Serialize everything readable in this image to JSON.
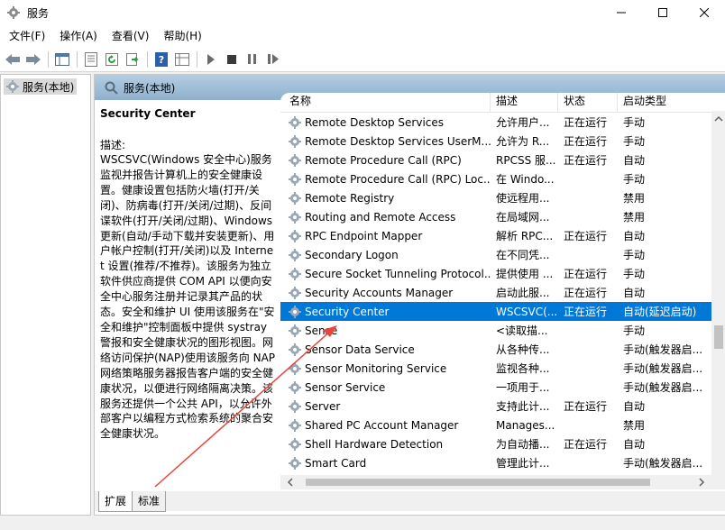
{
  "window": {
    "title": "服务"
  },
  "menu": [
    "文件(F)",
    "操作(A)",
    "查看(V)",
    "帮助(H)"
  ],
  "tree": {
    "root": "服务(本地)"
  },
  "panel": {
    "header": "服务(本地)"
  },
  "description": {
    "title": "Security Center",
    "label": "描述:",
    "body": "WSCSVC(Windows 安全中心)服务监视并报告计算机上的安全健康设置。健康设置包括防火墙(打开/关闭)、防病毒(打开/关闭/过期)、反间谍软件(打开/关闭/过期)、Windows 更新(自动/手动下载并安装更新)、用户帐户控制(打开/关闭)以及 Internet 设置(推荐/不推荐)。该服务为独立软件供应商提供 COM API 以便向安全中心服务注册并记录其产品的状态。安全和维护 UI 使用该服务在\"安全和维护\"控制面板中提供 systray 警报和安全健康状况的图形视图。网络访问保护(NAP)使用该服务向 NAP 网络策略服务器报告客户端的安全健康状况，以便进行网络隔离决策。该服务还提供一个公共 API，以允许外部客户以编程方式检索系统的聚合安全健康状况。"
  },
  "columns": {
    "name": "名称",
    "desc": "描述",
    "status": "状态",
    "startup": "启动类型"
  },
  "services": [
    {
      "name": "Remote Desktop Services",
      "desc": "允许用户...",
      "status": "正在运行",
      "startup": "手动"
    },
    {
      "name": "Remote Desktop Services UserM...",
      "desc": "允许为 R...",
      "status": "正在运行",
      "startup": "手动"
    },
    {
      "name": "Remote Procedure Call (RPC)",
      "desc": "RPCSS 服...",
      "status": "正在运行",
      "startup": "自动"
    },
    {
      "name": "Remote Procedure Call (RPC) Loc...",
      "desc": "在 Windo...",
      "status": "",
      "startup": "手动"
    },
    {
      "name": "Remote Registry",
      "desc": "使远程用...",
      "status": "",
      "startup": "禁用"
    },
    {
      "name": "Routing and Remote Access",
      "desc": "在局域网...",
      "status": "",
      "startup": "禁用"
    },
    {
      "name": "RPC Endpoint Mapper",
      "desc": "解析 RPC...",
      "status": "正在运行",
      "startup": "自动"
    },
    {
      "name": "Secondary Logon",
      "desc": "在不同凭...",
      "status": "",
      "startup": "手动"
    },
    {
      "name": "Secure Socket Tunneling Protocol...",
      "desc": "提供使用 ...",
      "status": "正在运行",
      "startup": "手动"
    },
    {
      "name": "Security Accounts Manager",
      "desc": "启动此服...",
      "status": "正在运行",
      "startup": "自动"
    },
    {
      "name": "Security Center",
      "desc": "WSCSVC(...",
      "status": "正在运行",
      "startup": "自动(延迟启动)"
    },
    {
      "name": "Sense",
      "desc": "<读取描...",
      "status": "",
      "startup": "手动"
    },
    {
      "name": "Sensor Data Service",
      "desc": "从各种传...",
      "status": "",
      "startup": "手动(触发器启..."
    },
    {
      "name": "Sensor Monitoring Service",
      "desc": "监视各种...",
      "status": "",
      "startup": "手动(触发器启..."
    },
    {
      "name": "Sensor Service",
      "desc": "一项用于...",
      "status": "",
      "startup": "手动(触发器启..."
    },
    {
      "name": "Server",
      "desc": "支持此计...",
      "status": "正在运行",
      "startup": "自动"
    },
    {
      "name": "Shared PC Account Manager",
      "desc": "Manages...",
      "status": "",
      "startup": "禁用"
    },
    {
      "name": "Shell Hardware Detection",
      "desc": "为自动播...",
      "status": "正在运行",
      "startup": "自动"
    },
    {
      "name": "Smart Card",
      "desc": "管理此计...",
      "status": "",
      "startup": "手动(触发器启..."
    }
  ],
  "selected_index": 10,
  "tabs": [
    "扩展",
    "标准"
  ],
  "colors": {
    "selection": "#0078d7",
    "header_gradient_top": "#b3cde3",
    "arrow": "#e8453c"
  },
  "icons": [
    "app-gear-icon",
    "minimize-icon",
    "maximize-icon",
    "close-icon",
    "back-icon",
    "forward-icon",
    "console-tree-icon",
    "properties-icon",
    "refresh-icon",
    "export-icon",
    "help-icon",
    "view-icon",
    "play-icon",
    "stop-icon",
    "pause-icon",
    "resume-icon",
    "service-gear-icon",
    "sort-caret-icon"
  ]
}
